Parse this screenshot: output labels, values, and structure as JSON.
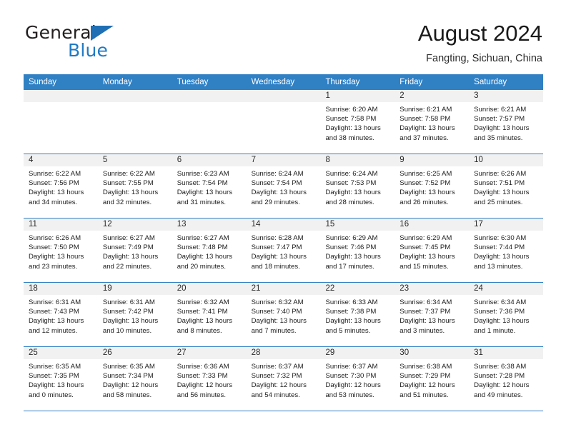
{
  "logo": {
    "word1": "General",
    "word2": "Blue",
    "triangle_color": "#1f6fb5",
    "blue_color": "#1f7ac4"
  },
  "header": {
    "title": "August 2024",
    "location": "Fangting, Sichuan, China"
  },
  "theme": {
    "header_blue": "#3080c4",
    "daynum_band": "#f1f1f1"
  },
  "weekdays": [
    "Sunday",
    "Monday",
    "Tuesday",
    "Wednesday",
    "Thursday",
    "Friday",
    "Saturday"
  ],
  "weeks": [
    [
      {
        "day": "",
        "empty": true
      },
      {
        "day": "",
        "empty": true
      },
      {
        "day": "",
        "empty": true
      },
      {
        "day": "",
        "empty": true
      },
      {
        "day": "1",
        "sunrise": "Sunrise: 6:20 AM",
        "sunset": "Sunset: 7:58 PM",
        "daylight1": "Daylight: 13 hours",
        "daylight2": "and 38 minutes."
      },
      {
        "day": "2",
        "sunrise": "Sunrise: 6:21 AM",
        "sunset": "Sunset: 7:58 PM",
        "daylight1": "Daylight: 13 hours",
        "daylight2": "and 37 minutes."
      },
      {
        "day": "3",
        "sunrise": "Sunrise: 6:21 AM",
        "sunset": "Sunset: 7:57 PM",
        "daylight1": "Daylight: 13 hours",
        "daylight2": "and 35 minutes."
      }
    ],
    [
      {
        "day": "4",
        "sunrise": "Sunrise: 6:22 AM",
        "sunset": "Sunset: 7:56 PM",
        "daylight1": "Daylight: 13 hours",
        "daylight2": "and 34 minutes."
      },
      {
        "day": "5",
        "sunrise": "Sunrise: 6:22 AM",
        "sunset": "Sunset: 7:55 PM",
        "daylight1": "Daylight: 13 hours",
        "daylight2": "and 32 minutes."
      },
      {
        "day": "6",
        "sunrise": "Sunrise: 6:23 AM",
        "sunset": "Sunset: 7:54 PM",
        "daylight1": "Daylight: 13 hours",
        "daylight2": "and 31 minutes."
      },
      {
        "day": "7",
        "sunrise": "Sunrise: 6:24 AM",
        "sunset": "Sunset: 7:54 PM",
        "daylight1": "Daylight: 13 hours",
        "daylight2": "and 29 minutes."
      },
      {
        "day": "8",
        "sunrise": "Sunrise: 6:24 AM",
        "sunset": "Sunset: 7:53 PM",
        "daylight1": "Daylight: 13 hours",
        "daylight2": "and 28 minutes."
      },
      {
        "day": "9",
        "sunrise": "Sunrise: 6:25 AM",
        "sunset": "Sunset: 7:52 PM",
        "daylight1": "Daylight: 13 hours",
        "daylight2": "and 26 minutes."
      },
      {
        "day": "10",
        "sunrise": "Sunrise: 6:26 AM",
        "sunset": "Sunset: 7:51 PM",
        "daylight1": "Daylight: 13 hours",
        "daylight2": "and 25 minutes."
      }
    ],
    [
      {
        "day": "11",
        "sunrise": "Sunrise: 6:26 AM",
        "sunset": "Sunset: 7:50 PM",
        "daylight1": "Daylight: 13 hours",
        "daylight2": "and 23 minutes."
      },
      {
        "day": "12",
        "sunrise": "Sunrise: 6:27 AM",
        "sunset": "Sunset: 7:49 PM",
        "daylight1": "Daylight: 13 hours",
        "daylight2": "and 22 minutes."
      },
      {
        "day": "13",
        "sunrise": "Sunrise: 6:27 AM",
        "sunset": "Sunset: 7:48 PM",
        "daylight1": "Daylight: 13 hours",
        "daylight2": "and 20 minutes."
      },
      {
        "day": "14",
        "sunrise": "Sunrise: 6:28 AM",
        "sunset": "Sunset: 7:47 PM",
        "daylight1": "Daylight: 13 hours",
        "daylight2": "and 18 minutes."
      },
      {
        "day": "15",
        "sunrise": "Sunrise: 6:29 AM",
        "sunset": "Sunset: 7:46 PM",
        "daylight1": "Daylight: 13 hours",
        "daylight2": "and 17 minutes."
      },
      {
        "day": "16",
        "sunrise": "Sunrise: 6:29 AM",
        "sunset": "Sunset: 7:45 PM",
        "daylight1": "Daylight: 13 hours",
        "daylight2": "and 15 minutes."
      },
      {
        "day": "17",
        "sunrise": "Sunrise: 6:30 AM",
        "sunset": "Sunset: 7:44 PM",
        "daylight1": "Daylight: 13 hours",
        "daylight2": "and 13 minutes."
      }
    ],
    [
      {
        "day": "18",
        "sunrise": "Sunrise: 6:31 AM",
        "sunset": "Sunset: 7:43 PM",
        "daylight1": "Daylight: 13 hours",
        "daylight2": "and 12 minutes."
      },
      {
        "day": "19",
        "sunrise": "Sunrise: 6:31 AM",
        "sunset": "Sunset: 7:42 PM",
        "daylight1": "Daylight: 13 hours",
        "daylight2": "and 10 minutes."
      },
      {
        "day": "20",
        "sunrise": "Sunrise: 6:32 AM",
        "sunset": "Sunset: 7:41 PM",
        "daylight1": "Daylight: 13 hours",
        "daylight2": "and 8 minutes."
      },
      {
        "day": "21",
        "sunrise": "Sunrise: 6:32 AM",
        "sunset": "Sunset: 7:40 PM",
        "daylight1": "Daylight: 13 hours",
        "daylight2": "and 7 minutes."
      },
      {
        "day": "22",
        "sunrise": "Sunrise: 6:33 AM",
        "sunset": "Sunset: 7:38 PM",
        "daylight1": "Daylight: 13 hours",
        "daylight2": "and 5 minutes."
      },
      {
        "day": "23",
        "sunrise": "Sunrise: 6:34 AM",
        "sunset": "Sunset: 7:37 PM",
        "daylight1": "Daylight: 13 hours",
        "daylight2": "and 3 minutes."
      },
      {
        "day": "24",
        "sunrise": "Sunrise: 6:34 AM",
        "sunset": "Sunset: 7:36 PM",
        "daylight1": "Daylight: 13 hours",
        "daylight2": "and 1 minute."
      }
    ],
    [
      {
        "day": "25",
        "sunrise": "Sunrise: 6:35 AM",
        "sunset": "Sunset: 7:35 PM",
        "daylight1": "Daylight: 13 hours",
        "daylight2": "and 0 minutes."
      },
      {
        "day": "26",
        "sunrise": "Sunrise: 6:35 AM",
        "sunset": "Sunset: 7:34 PM",
        "daylight1": "Daylight: 12 hours",
        "daylight2": "and 58 minutes."
      },
      {
        "day": "27",
        "sunrise": "Sunrise: 6:36 AM",
        "sunset": "Sunset: 7:33 PM",
        "daylight1": "Daylight: 12 hours",
        "daylight2": "and 56 minutes."
      },
      {
        "day": "28",
        "sunrise": "Sunrise: 6:37 AM",
        "sunset": "Sunset: 7:32 PM",
        "daylight1": "Daylight: 12 hours",
        "daylight2": "and 54 minutes."
      },
      {
        "day": "29",
        "sunrise": "Sunrise: 6:37 AM",
        "sunset": "Sunset: 7:30 PM",
        "daylight1": "Daylight: 12 hours",
        "daylight2": "and 53 minutes."
      },
      {
        "day": "30",
        "sunrise": "Sunrise: 6:38 AM",
        "sunset": "Sunset: 7:29 PM",
        "daylight1": "Daylight: 12 hours",
        "daylight2": "and 51 minutes."
      },
      {
        "day": "31",
        "sunrise": "Sunrise: 6:38 AM",
        "sunset": "Sunset: 7:28 PM",
        "daylight1": "Daylight: 12 hours",
        "daylight2": "and 49 minutes."
      }
    ]
  ]
}
